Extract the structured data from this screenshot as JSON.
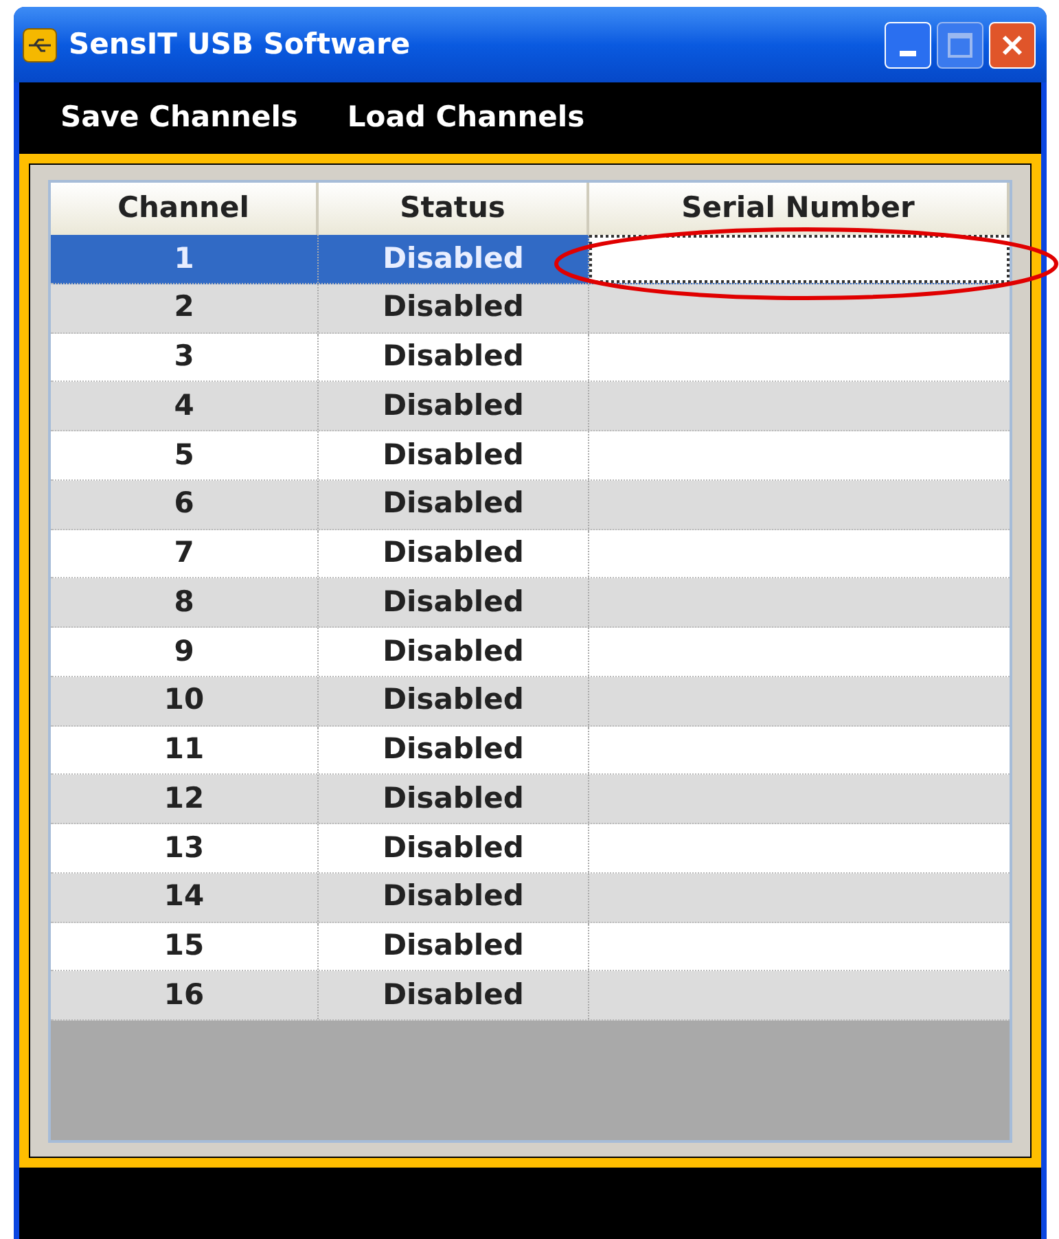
{
  "window": {
    "title": "SensIT USB Software"
  },
  "menu": [
    "Save Channels",
    "Load Channels"
  ],
  "table": {
    "columns": [
      "Channel",
      "Status",
      "Serial Number"
    ],
    "rows": [
      {
        "channel": "1",
        "status": "Disabled",
        "selected": true
      },
      {
        "channel": "2",
        "status": "Disabled",
        "selected": false
      },
      {
        "channel": "3",
        "status": "Disabled",
        "selected": false
      },
      {
        "channel": "4",
        "status": "Disabled",
        "selected": false
      },
      {
        "channel": "5",
        "status": "Disabled",
        "selected": false
      },
      {
        "channel": "6",
        "status": "Disabled",
        "selected": false
      },
      {
        "channel": "7",
        "status": "Disabled",
        "selected": false
      },
      {
        "channel": "8",
        "status": "Disabled",
        "selected": false
      },
      {
        "channel": "9",
        "status": "Disabled",
        "selected": false
      },
      {
        "channel": "10",
        "status": "Disabled",
        "selected": false
      },
      {
        "channel": "11",
        "status": "Disabled",
        "selected": false
      },
      {
        "channel": "12",
        "status": "Disabled",
        "selected": false
      },
      {
        "channel": "13",
        "status": "Disabled",
        "selected": false
      },
      {
        "channel": "14",
        "status": "Disabled",
        "selected": false
      },
      {
        "channel": "15",
        "status": "Disabled",
        "selected": false
      },
      {
        "channel": "16",
        "status": "Disabled",
        "selected": false
      }
    ]
  }
}
